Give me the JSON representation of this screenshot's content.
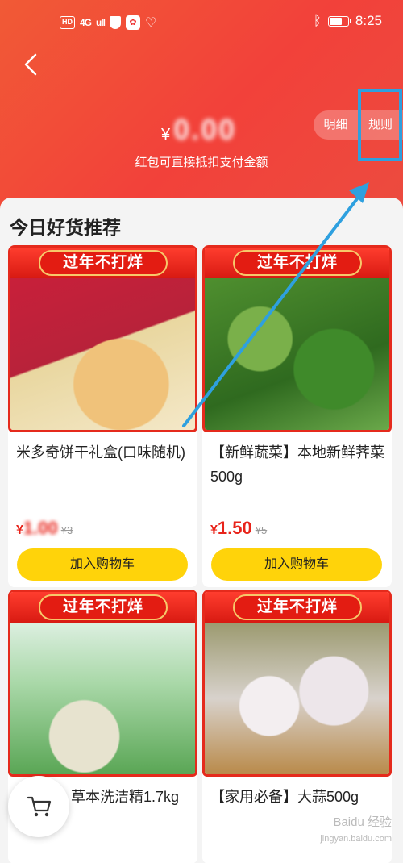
{
  "status_bar": {
    "left_badges": [
      "HD",
      "4G"
    ],
    "signal": "ull",
    "time": "8:25",
    "battery_level": 0.7
  },
  "header": {
    "currency": "¥",
    "amount_masked": "0.00",
    "subtitle": "红包可直接抵扣支付金额",
    "tabs": [
      "明细",
      "规则"
    ]
  },
  "section_title": "今日好货推荐",
  "products": [
    {
      "promo": "过年不打烊",
      "title": "米多奇饼干礼盒(口味随机)",
      "currency": "¥",
      "price": "1.00",
      "old_price": "¥3",
      "button": "加入购物车"
    },
    {
      "promo": "过年不打烊",
      "title": "【新鲜蔬菜】本地新鲜荠菜500g",
      "currency": "¥",
      "price": "1.50",
      "old_price": "¥5",
      "button": "加入购物车"
    },
    {
      "promo": "过年不打烊",
      "title": "草本洗洁精1.7kg",
      "currency": "",
      "price": "",
      "old_price": "",
      "button": ""
    },
    {
      "promo": "过年不打烊",
      "title": "【家用必备】大蒜500g",
      "currency": "",
      "price": "",
      "old_price": "",
      "button": ""
    }
  ],
  "icons": {
    "back": "chevron-left-icon",
    "cart": "shopping-cart-icon"
  },
  "colors": {
    "header_red": "#f2413a",
    "price_red": "#e8231a",
    "button_yellow": "#ffd30a",
    "highlight_blue": "#2ea0df"
  },
  "watermark": {
    "line1": "Baidu 经验",
    "line2": "jingyan.baidu.com"
  }
}
